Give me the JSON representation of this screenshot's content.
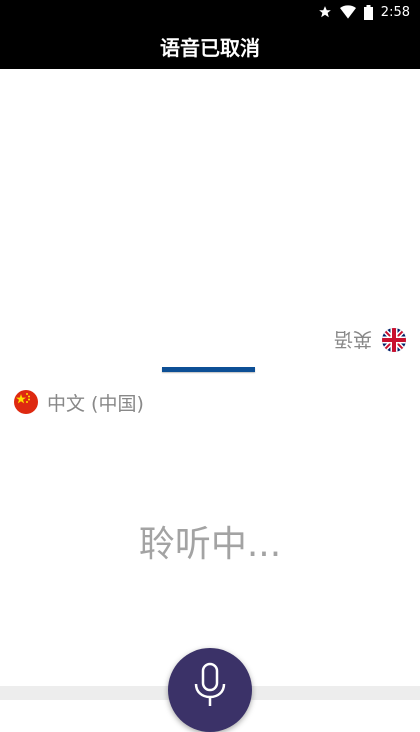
{
  "status_bar": {
    "time": "2:58",
    "icons": [
      "star-icon",
      "wifi-icon",
      "battery-icon"
    ]
  },
  "header": {
    "title": "语音已取消"
  },
  "target_language": {
    "label": "英语",
    "flag": "uk-flag-icon"
  },
  "source_language": {
    "label": "中文 (中国)",
    "flag": "china-flag-icon"
  },
  "listening": {
    "text": "聆听中..."
  },
  "mic_button": {
    "icon": "microphone-icon"
  },
  "colors": {
    "header_bg": "#000000",
    "divider": "#0d4f95",
    "mic_button_bg": "#3b3268",
    "text_gray": "#888888"
  }
}
